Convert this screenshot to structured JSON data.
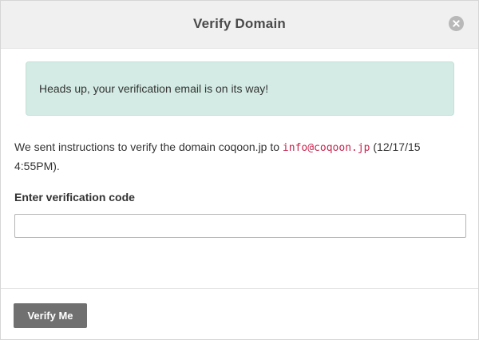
{
  "modal": {
    "title": "Verify Domain",
    "close_icon": "close-circle-icon"
  },
  "alert": {
    "text": "Heads up, your verification email is on its way!",
    "color": "#d3ebe4"
  },
  "info": {
    "prefix": "We sent instructions to verify the domain coqoon.jp to ",
    "email": "info@coqoon.jp",
    "suffix": " (12/17/15 4:55PM)."
  },
  "form": {
    "code_label": "Enter verification code",
    "code_value": "",
    "submit_label": "Verify Me"
  },
  "colors": {
    "email_code": "#c7254e",
    "button": "#707070"
  }
}
